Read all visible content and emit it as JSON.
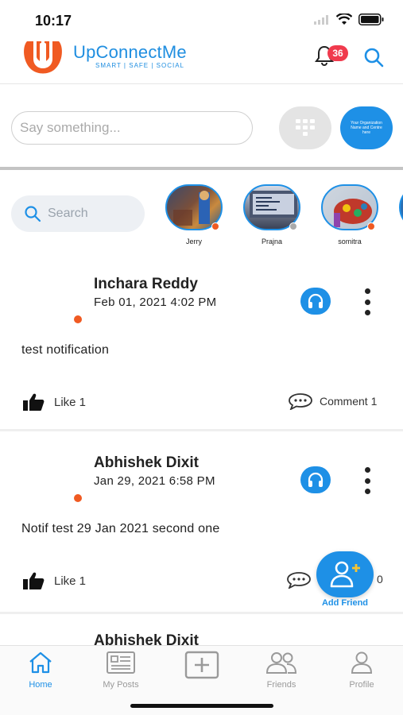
{
  "status_bar": {
    "time": "10:17"
  },
  "header": {
    "brand_name": "UpConnectMe",
    "brand_tagline": "SMART | SAFE | SOCIAL",
    "notification_count": "36",
    "colors": {
      "brand_blue": "#1f8ee0",
      "logo_orange": "#f05a22",
      "badge_red": "#f03a4d"
    }
  },
  "composer": {
    "placeholder": "Say something...",
    "org_button_text": "Your Organization Name and Centre here"
  },
  "stories": {
    "search_placeholder": "Search",
    "items": [
      {
        "name": "Jerry",
        "status_color": "#f05a22"
      },
      {
        "name": "Prajna",
        "status_color": "#aaaaaa"
      },
      {
        "name": "somitra",
        "status_color": "#f05a22"
      }
    ]
  },
  "posts": [
    {
      "author": "Inchara Reddy",
      "date": "Feb 01, 2021 4:02 PM",
      "text": "test notification",
      "like_label": "Like 1",
      "comment_label": "Comment 1"
    },
    {
      "author": "Abhishek Dixit",
      "date": "Jan 29, 2021 6:58 PM",
      "text": "Notif test 29 Jan 2021 second one",
      "like_label": "Like 1",
      "comment_count": "0"
    },
    {
      "author": "Abhishek Dixit"
    }
  ],
  "fab": {
    "label": "Add Friend"
  },
  "tabbar": {
    "tabs": [
      {
        "label": "Home",
        "active": true
      },
      {
        "label": "My Posts",
        "active": false
      },
      {
        "label": "",
        "active": false
      },
      {
        "label": "Friends",
        "active": false
      },
      {
        "label": "Profile",
        "active": false
      }
    ]
  }
}
